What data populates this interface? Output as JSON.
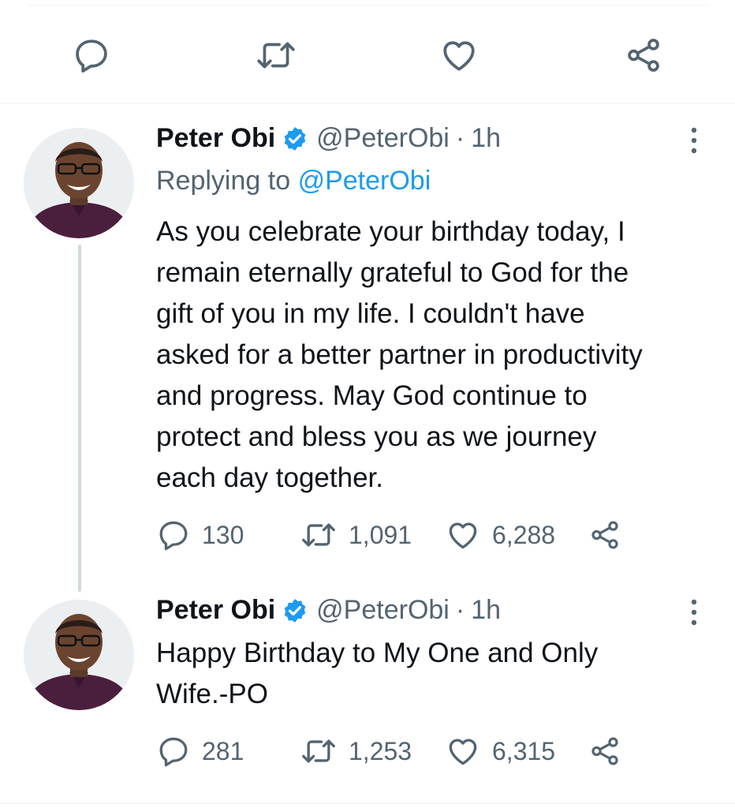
{
  "top_actions": {
    "reply_icon": "reply-icon",
    "retweet_icon": "retweet-icon",
    "like_icon": "heart-icon",
    "share_icon": "share-icon"
  },
  "tweets": [
    {
      "name": "Peter Obi",
      "handle": "@PeterObi",
      "separator": "·",
      "time": "1h",
      "replying_prefix": "Replying to",
      "replying_handle": "@PeterObi",
      "text": "As you celebrate your birthday today, I\nremain eternally grateful to God for the\ngift of you in my life. I couldn't have\nasked for a better partner in productivity\nand progress. May God continue to\nprotect and bless you as we journey\neach day together.",
      "replies": "130",
      "retweets": "1,091",
      "likes": "6,288"
    },
    {
      "name": "Peter Obi",
      "handle": "@PeterObi",
      "separator": "·",
      "time": "1h",
      "text": "Happy Birthday to My One and Only\nWife.-PO",
      "replies": "281",
      "retweets": "1,253",
      "likes": "6,315"
    }
  ],
  "colors": {
    "accent": "#1d9bf0",
    "text_secondary": "#536471",
    "divider": "#eff3f4",
    "thread_line": "#cfd9de"
  }
}
